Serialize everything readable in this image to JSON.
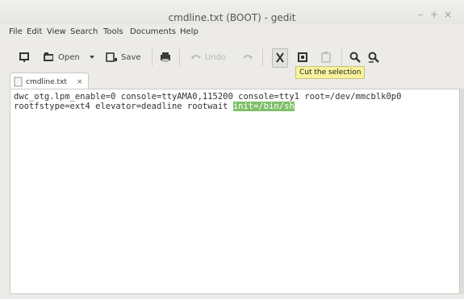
{
  "window": {
    "title": "cmdline.txt (BOOT) - gedit",
    "controls": {
      "minimize": "–",
      "maximize": "+",
      "close": "×"
    }
  },
  "menubar": {
    "items": [
      "File",
      "Edit",
      "View",
      "Search",
      "Tools",
      "Documents",
      "Help"
    ]
  },
  "toolbar": {
    "open_label": "Open",
    "save_label": "Save",
    "undo_label": "Undo",
    "icons": [
      "new-document-icon",
      "open-folder-icon",
      "dropdown-arrow-icon",
      "save-icon",
      "print-icon",
      "undo-icon",
      "redo-icon",
      "cut-icon",
      "copy-icon",
      "paste-icon",
      "find-icon",
      "find-replace-icon"
    ]
  },
  "tooltip": {
    "text": "Cut the selection"
  },
  "tabs": [
    {
      "label": "cmdline.txt",
      "close": "×"
    }
  ],
  "editor": {
    "line1": "dwc_otg.lpm_enable=0 console=ttyAMA0,115200 console=tty1 root=/dev/mmcblk0p0",
    "line2_prefix": "rootfstype=ext4 elevator=deadline rootwait ",
    "line2_selected": "init=/bin/sh"
  },
  "colors": {
    "selection": "#7fbf6a",
    "tooltip_bg": "#f6f29e"
  }
}
